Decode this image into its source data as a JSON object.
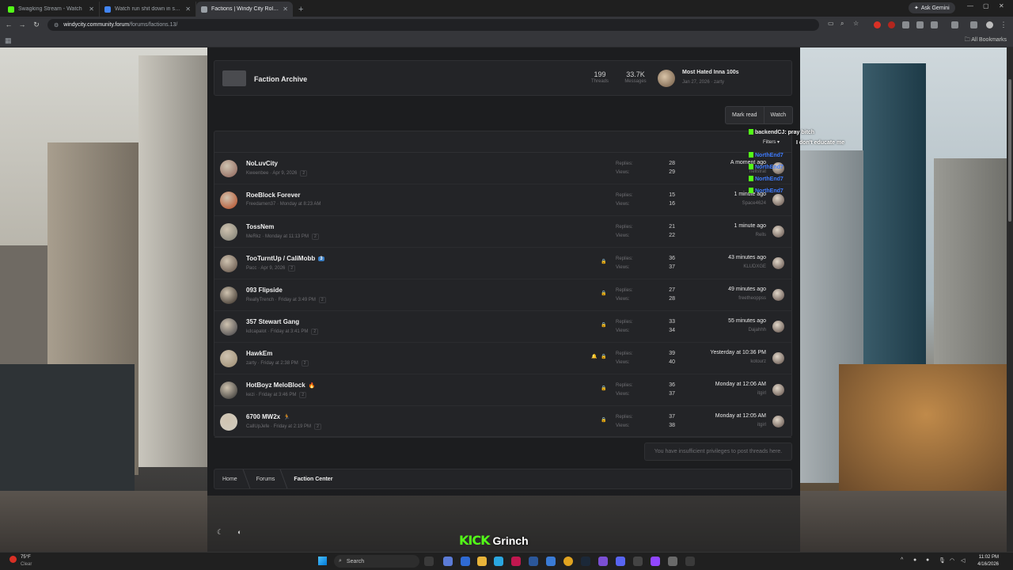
{
  "browser": {
    "tabs": [
      {
        "label": "Swagking Stream - Watch",
        "active": false,
        "favicon_color": "#53fc18"
      },
      {
        "label": "Watch run shit down in some",
        "active": false,
        "favicon_color": "#4285f4"
      },
      {
        "label": "Factions | Windy City Roleplay",
        "active": true,
        "favicon_color": "#9aa0a6"
      }
    ],
    "new_tab_label": "+",
    "ask_gemini_label": "Ask Gemini",
    "url_host": "windycity.community.forum",
    "url_path": "/forums/factions.13/",
    "all_bookmarks_label": "All Bookmarks"
  },
  "archive": {
    "name": "Faction Archive",
    "threads": "199",
    "threads_label": "Threads",
    "messages": "33.7K",
    "messages_label": "Messages",
    "last_title": "Most Hated Inna 100s",
    "last_meta": "Jan 27, 2026 · zarty"
  },
  "actions": {
    "mark_read": "Mark read",
    "watch": "Watch"
  },
  "labels": {
    "replies": "Replies:",
    "views": "Views:"
  },
  "threads": [
    {
      "title": "NoLuvCity",
      "author": "Kweenbee",
      "date": "Apr 9, 2026",
      "pages": "2",
      "replies": "28",
      "views": "29",
      "last_time": "A moment ago",
      "last_user": "nellstrat",
      "locked": false,
      "watched": false,
      "badge": "",
      "emoji": "",
      "avatar_color": "#8a5e55"
    },
    {
      "title": "RoeBlock Forever",
      "author": "Freedamen37",
      "date": "Monday at 8:23 AM",
      "pages": "",
      "replies": "15",
      "views": "16",
      "last_time": "1 minute ago",
      "last_user": "Space4624",
      "locked": false,
      "watched": false,
      "badge": "",
      "emoji": "",
      "avatar_color": "#b4461e"
    },
    {
      "title": "TossNem",
      "author": "MeRkz",
      "date": "Monday at 11:13 PM",
      "pages": "2",
      "replies": "21",
      "views": "22",
      "last_time": "1 minute ago",
      "last_user": "Rells",
      "locked": false,
      "watched": false,
      "badge": "",
      "emoji": "",
      "avatar_color": "#7a7a70"
    },
    {
      "title": "TooTurntUp / CaliMobb",
      "author": "Pacc",
      "date": "Apr 9, 2026",
      "pages": "2",
      "replies": "36",
      "views": "37",
      "last_time": "43 minutes ago",
      "last_user": "KLUDXGE",
      "locked": true,
      "watched": false,
      "badge": "3",
      "emoji": "",
      "avatar_color": "#5a4a40"
    },
    {
      "title": "093 Flipside",
      "author": "ReallyTrench",
      "date": "Friday at 3:49 PM",
      "pages": "2",
      "replies": "27",
      "views": "28",
      "last_time": "49 minutes ago",
      "last_user": "freetheoppss",
      "locked": true,
      "watched": false,
      "badge": "",
      "emoji": "",
      "avatar_color": "#2e2620"
    },
    {
      "title": "357 Stewart Gang",
      "author": "kdcapalot",
      "date": "Friday at 3:41 PM",
      "pages": "2",
      "replies": "33",
      "views": "34",
      "last_time": "55 minutes ago",
      "last_user": "Dajahhh",
      "locked": true,
      "watched": false,
      "badge": "",
      "emoji": "",
      "avatar_color": "#3a3a40"
    },
    {
      "title": "HawkEm",
      "author": "zarty",
      "date": "Friday at 2:38 PM",
      "pages": "2",
      "replies": "39",
      "views": "40",
      "last_time": "Yesterday at 10:36 PM",
      "last_user": "kotourz",
      "locked": true,
      "watched": true,
      "badge": "",
      "emoji": "",
      "avatar_color": "#9a8a70"
    },
    {
      "title": "HotBoyz MeloBlock",
      "author": "kezi",
      "date": "Friday at 3:46 PM",
      "pages": "2",
      "replies": "36",
      "views": "37",
      "last_time": "Monday at 12:06 AM",
      "last_user": "itgirl",
      "locked": true,
      "watched": false,
      "badge": "",
      "emoji": "🔥",
      "avatar_color": "#2a2a2a"
    },
    {
      "title": "6700 MW2x",
      "author": "CallUpJefe",
      "date": "Friday at 2:19 PM",
      "pages": "2",
      "replies": "37",
      "views": "38",
      "last_time": "Monday at 12:05 AM",
      "last_user": "itgirl",
      "locked": true,
      "watched": false,
      "badge": "",
      "emoji": "🏃",
      "avatar_color": "#d0ccc0"
    }
  ],
  "no_privileges": "You have insufficient privileges to post threads here.",
  "breadcrumbs": [
    "Home",
    "Forums",
    "Faction Center"
  ],
  "chat": {
    "filters_label": "Filters ▾",
    "lines": [
      {
        "user": "backendCJ",
        "msg": ": pray bitch",
        "blue": false
      },
      {
        "user": "",
        "msg": "I don't educate me",
        "blue": false
      },
      {
        "user": "NorthEnd7",
        "msg": "",
        "blue": true
      },
      {
        "user": "NorthEnd7",
        "msg": "",
        "blue": true
      },
      {
        "user": "NorthEnd7",
        "msg": "",
        "blue": true
      },
      {
        "user": "NorthEnd7",
        "msg": "",
        "blue": true
      }
    ]
  },
  "kick": {
    "logo": "KICK",
    "streamer": "Grinch"
  },
  "taskbar": {
    "temp": "75°F",
    "condition": "Clear",
    "search_placeholder": "Search",
    "time": "11:02 PM",
    "date": "4/16/2026"
  }
}
